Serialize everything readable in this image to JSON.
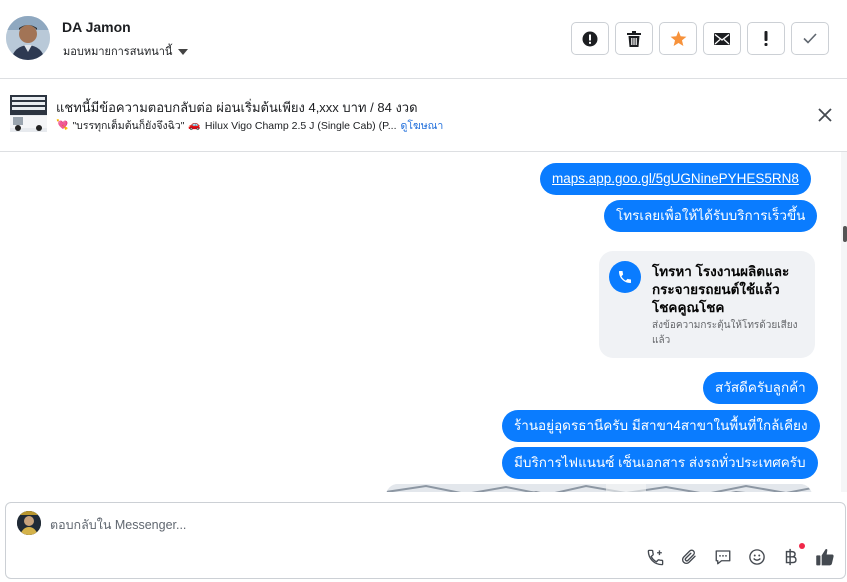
{
  "header": {
    "contact_name": "DA Jamon",
    "assign_label": "มอบหมายการสนทนานี้",
    "actions": [
      {
        "name": "spam-button",
        "icon": "alert-circle-icon"
      },
      {
        "name": "delete-button",
        "icon": "trash-icon"
      },
      {
        "name": "star-button",
        "icon": "star-icon"
      },
      {
        "name": "mark-unread-button",
        "icon": "envelope-icon"
      },
      {
        "name": "priority-button",
        "icon": "exclamation-icon"
      },
      {
        "name": "done-button",
        "icon": "check-icon"
      }
    ],
    "colors": {
      "star": "#f7923b"
    }
  },
  "context": {
    "title": "แชทนี้มีข้อความตอบกลับต่อ ผ่อนเริ่มต้นเพียง 4,xxx บาท / 84 งวด",
    "ad_text": "\"บรรทุกเต็มต้นก็ยังจึงฉิว\"",
    "vehicle_text": "Hilux Vigo Champ 2.5 J (Single Cab) (P...",
    "view_ad_link": "ดูโฆษณา"
  },
  "messages": [
    {
      "type": "link",
      "text": "maps.app.goo.gl/5gUGNinePYHES5RN8"
    },
    {
      "type": "text",
      "text": "โทรเลยเพื่อให้ได้รับบริการเร็วขึ้น"
    },
    {
      "type": "call",
      "title": "โทรหา โรงงานผลิตและกระจายรถยนต์ใช้แล้ว โชคคูณโชค",
      "subtitle": "ส่งข้อความกระตุ้นให้โทรด้วยเสียงแล้ว"
    },
    {
      "type": "text",
      "text": "สวัสดีครับลูกค้า"
    },
    {
      "type": "text",
      "text": "ร้านอยู่อุดรธานีครับ มีสาขา4สาขาในพื้นที่ใกล้เคียง"
    },
    {
      "type": "text",
      "text": "มีบริการไฟแนนซ์ เซ็นเอกสาร ส่งรถทั่วประเทศครับ"
    }
  ],
  "composer": {
    "placeholder": "ตอบกลับใน Messenger...",
    "tools": [
      "phone-plus-icon",
      "paperclip-icon",
      "chat-bubble-icon",
      "emoji-icon",
      "baht-icon",
      "thumbs-up-icon"
    ]
  },
  "colors": {
    "bubble": "#0a7cff",
    "link": "#216fdb"
  }
}
